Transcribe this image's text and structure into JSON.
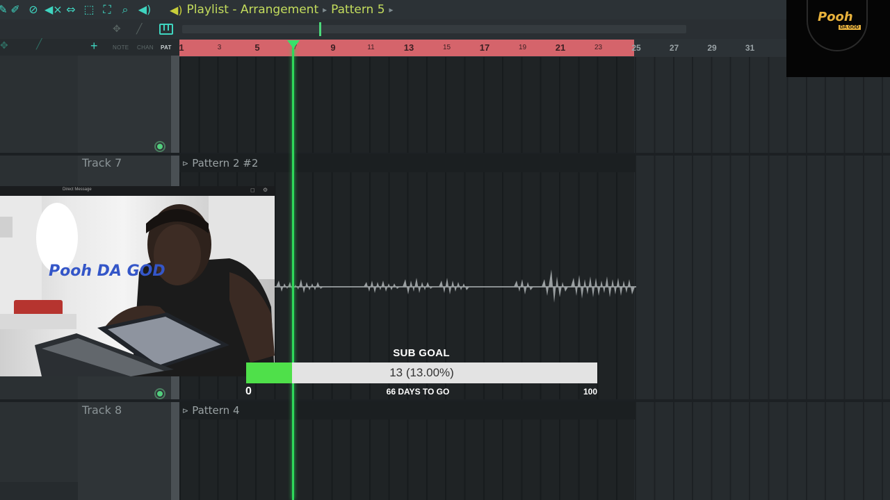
{
  "toolbar": {
    "breadcrumb": [
      "Playlist - Arrangement",
      "Pattern 5"
    ],
    "icons": [
      "brush-icon",
      "mute-icon",
      "slip-icon",
      "zoom-icon",
      "speaker-icon"
    ]
  },
  "mode_labels": {
    "note": "NOTE",
    "chan": "CHAN",
    "pat": "PAT"
  },
  "ruler": {
    "highlighted_bars": [
      "1",
      "3",
      "5",
      "7",
      "9",
      "11",
      "13",
      "15",
      "17",
      "19",
      "21",
      "23"
    ],
    "bars": [
      "25",
      "27",
      "29",
      "31"
    ]
  },
  "tracks": [
    {
      "label": "Track 7",
      "clip": "Pattern 2 #2"
    },
    {
      "label": "Track 8",
      "clip": "Pattern 4"
    }
  ],
  "webcam": {
    "window_title": "Direct Message",
    "watermark": "Pooh DA GOD"
  },
  "logo": {
    "name": "Pooh",
    "tagline": "DA GOD"
  },
  "sub_goal": {
    "title": "SUB GOAL",
    "current": 13,
    "target": 100,
    "progress_text": "13 (13.00%)",
    "min_label": "0",
    "max_label": "100",
    "days_left": "66 DAYS TO GO",
    "fill_fraction": 0.13
  },
  "colors": {
    "ruler_selection": "#d5646b",
    "playhead": "#2fd85a",
    "accent": "#3fd5c0",
    "title": "#c4dd5d",
    "goal_fill": "#4fe04a"
  }
}
